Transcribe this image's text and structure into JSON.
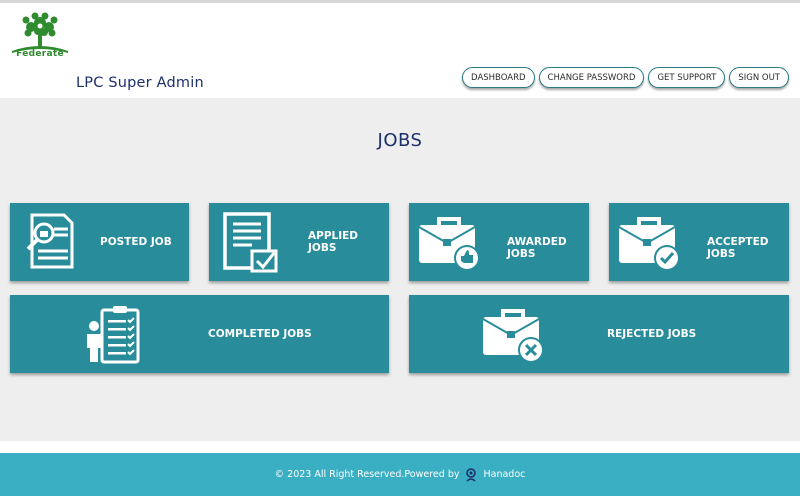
{
  "brand": {
    "logo_text": "Federate",
    "colors": {
      "leaf": "#2e8b2e",
      "accent": "#288c9a"
    }
  },
  "header": {
    "title": "LPC Super Admin"
  },
  "nav": [
    {
      "label": "DASHBOARD"
    },
    {
      "label": "CHANGE PASSWORD"
    },
    {
      "label": "GET SUPPORT"
    },
    {
      "label": "SIGN OUT"
    }
  ],
  "main": {
    "title": "JOBS",
    "cards": [
      {
        "label": "POSTED JOB",
        "icon": "document-search-icon"
      },
      {
        "label": "APPLIED JOBS",
        "icon": "checklist-document-icon"
      },
      {
        "label": "AWARDED JOBS",
        "icon": "briefcase-thumbs-up-icon"
      },
      {
        "label": "ACCEPTED JOBS",
        "icon": "briefcase-check-icon"
      },
      {
        "label": "COMPLETED JOBS",
        "icon": "person-clipboard-icon"
      },
      {
        "label": "REJECTED JOBS",
        "icon": "briefcase-x-icon"
      }
    ]
  },
  "footer": {
    "text": "© 2023 All Right Reserved.Powered by",
    "brand": "Hanadoc",
    "icon": "hanadoc-logo-icon"
  }
}
